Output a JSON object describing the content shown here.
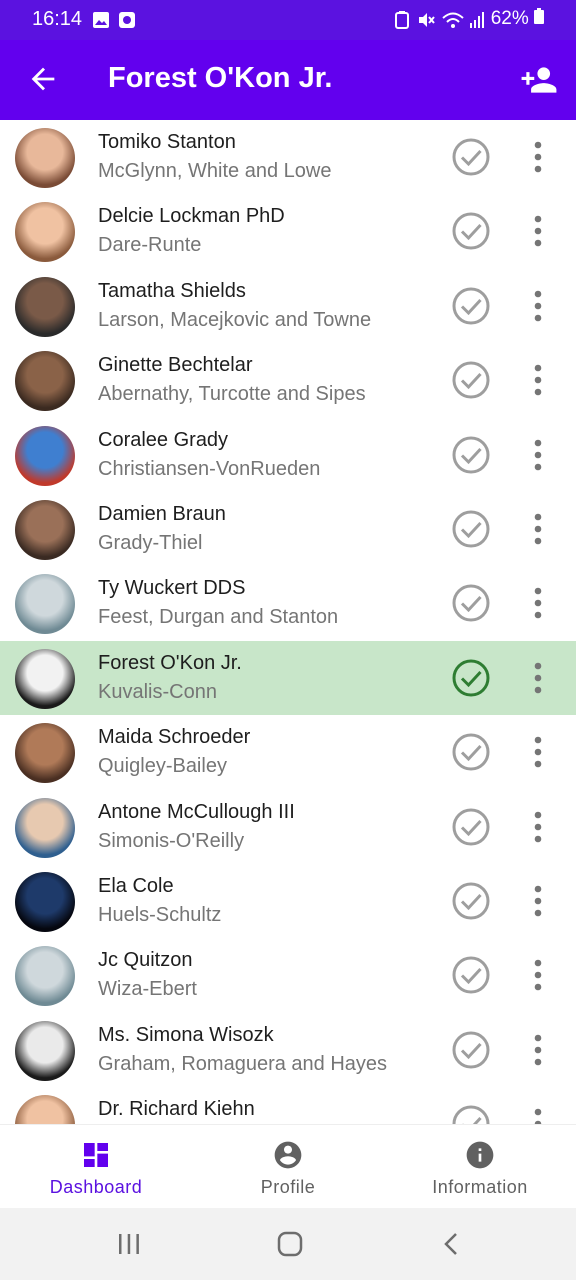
{
  "status_bar": {
    "time": "16:14",
    "battery": "62%"
  },
  "app_bar": {
    "title": "Forest O'Kon Jr.",
    "back_icon": "arrow-back-icon",
    "action_icon": "person-add-icon"
  },
  "contacts": [
    {
      "name": "Tomiko Stanton",
      "company": "McGlynn, White and Lowe",
      "selected": false
    },
    {
      "name": "Delcie Lockman PhD",
      "company": "Dare-Runte",
      "selected": false
    },
    {
      "name": "Tamatha Shields",
      "company": "Larson, Macejkovic and Towne",
      "selected": false
    },
    {
      "name": "Ginette Bechtelar",
      "company": "Abernathy, Turcotte and Sipes",
      "selected": false
    },
    {
      "name": "Coralee Grady",
      "company": "Christiansen-VonRueden",
      "selected": false
    },
    {
      "name": "Damien Braun",
      "company": "Grady-Thiel",
      "selected": false
    },
    {
      "name": "Ty Wuckert DDS",
      "company": "Feest, Durgan and Stanton",
      "selected": false
    },
    {
      "name": "Forest O'Kon Jr.",
      "company": "Kuvalis-Conn",
      "selected": true
    },
    {
      "name": "Maida Schroeder",
      "company": "Quigley-Bailey",
      "selected": false
    },
    {
      "name": "Antone McCullough III",
      "company": "Simonis-O'Reilly",
      "selected": false
    },
    {
      "name": "Ela Cole",
      "company": "Huels-Schultz",
      "selected": false
    },
    {
      "name": "Jc Quitzon",
      "company": "Wiza-Ebert",
      "selected": false
    },
    {
      "name": "Ms. Simona Wisozk",
      "company": "Graham, Romaguera and Hayes",
      "selected": false
    },
    {
      "name": "Dr. Richard Kiehn",
      "company": "",
      "selected": false
    }
  ],
  "bottom_nav": [
    {
      "label": "Dashboard",
      "icon": "dashboard-icon",
      "active": true
    },
    {
      "label": "Profile",
      "icon": "account-circle-icon",
      "active": false
    },
    {
      "label": "Information",
      "icon": "info-icon",
      "active": false
    }
  ],
  "colors": {
    "primary": "#6200ee",
    "status_bar": "#5b12e0",
    "selected_row": "#c8e6c9",
    "check_selected": "#2e7d32",
    "check_default": "#9e9e9e"
  }
}
